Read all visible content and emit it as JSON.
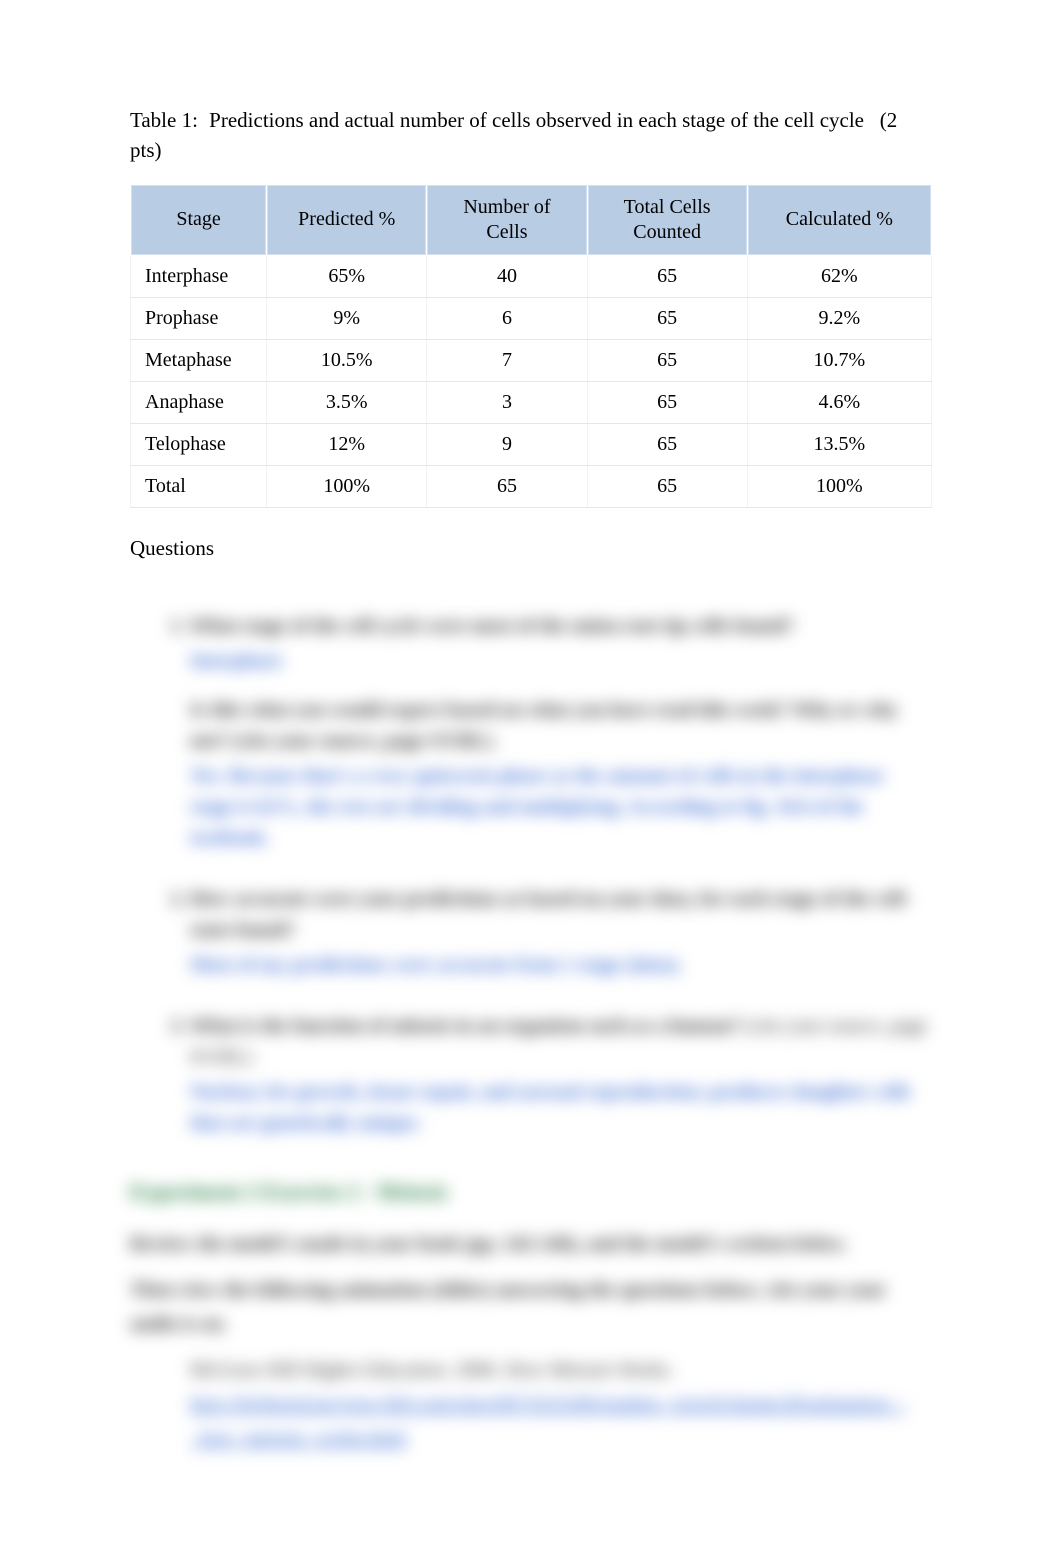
{
  "caption": {
    "label": "Table 1:",
    "text": "Predictions and actual number of cells observed in each stage of the cell cycle",
    "points": "(2 pts)"
  },
  "table": {
    "headers": {
      "stage": "Stage",
      "predicted": "Predicted %",
      "number_line1": "Number of",
      "number_line2": "Cells",
      "total_line1": "Total Cells",
      "total_line2": "Counted",
      "calculated": "Calculated %"
    },
    "rows": [
      {
        "stage": "Interphase",
        "predicted": "65%",
        "number": "40",
        "total": "65",
        "calculated": "62%"
      },
      {
        "stage": "Prophase",
        "predicted": "9%",
        "number": "6",
        "total": "65",
        "calculated": "9.2%"
      },
      {
        "stage": "Metaphase",
        "predicted": "10.5%",
        "number": "7",
        "total": "65",
        "calculated": "10.7%"
      },
      {
        "stage": "Anaphase",
        "predicted": "3.5%",
        "number": "3",
        "total": "65",
        "calculated": "4.6%"
      },
      {
        "stage": "Telophase",
        "predicted": "12%",
        "number": "9",
        "total": "65",
        "calculated": "13.5%"
      },
      {
        "stage": "Total",
        "predicted": "100%",
        "number": "65",
        "total": "65",
        "calculated": "100%"
      }
    ]
  },
  "questions_heading": "Questions",
  "blur": {
    "q1_text": "What stage of the cell cycle were most of the onion root tip cells found?",
    "q1_ans": "Interphase",
    "q1b_text": "Is this what you would expect based on what you have read this week?  Why or why not? (cite your source, page #/URL)",
    "q1b_ans": "Yes. Because that's a very quiescent phase as the amount of cells in the interphase stage is 62%, the rest are dividing and multiplying. According to fig. 10.6 of the textbook.",
    "q2_text": "How accurate were your predictions as based on your data, for each stage of the cell-state found?",
    "q2_ans": "Most of my predictions were accurate from 1 stage (data).",
    "q3_text": "What is the function of mitosis in an organism such as a human?",
    "q3_cite": "(cite your source, page #/URL)",
    "q3_ans": "  Nuclear, for growth, tissue repair, and asexual reproduction; produces daughter cells that are genetically unique.",
    "exp_heading": "Experiment 2 Exercise 2 - Meiosis",
    "p1": "Review the model's made in your book (pp. 242-246), and the model's written below.",
    "p2": "Then view the following animation (slides) answering the questions below; cite your your audio is on.",
    "ref_black": "McGraw-Hill Higher Education. 2006. How Meiosis Works.",
    "ref_link": "http://highered.mcgraw-hill.com/sites/0073525200/student_view0/chapter28/animation_-_how_meiosis_works.html"
  }
}
